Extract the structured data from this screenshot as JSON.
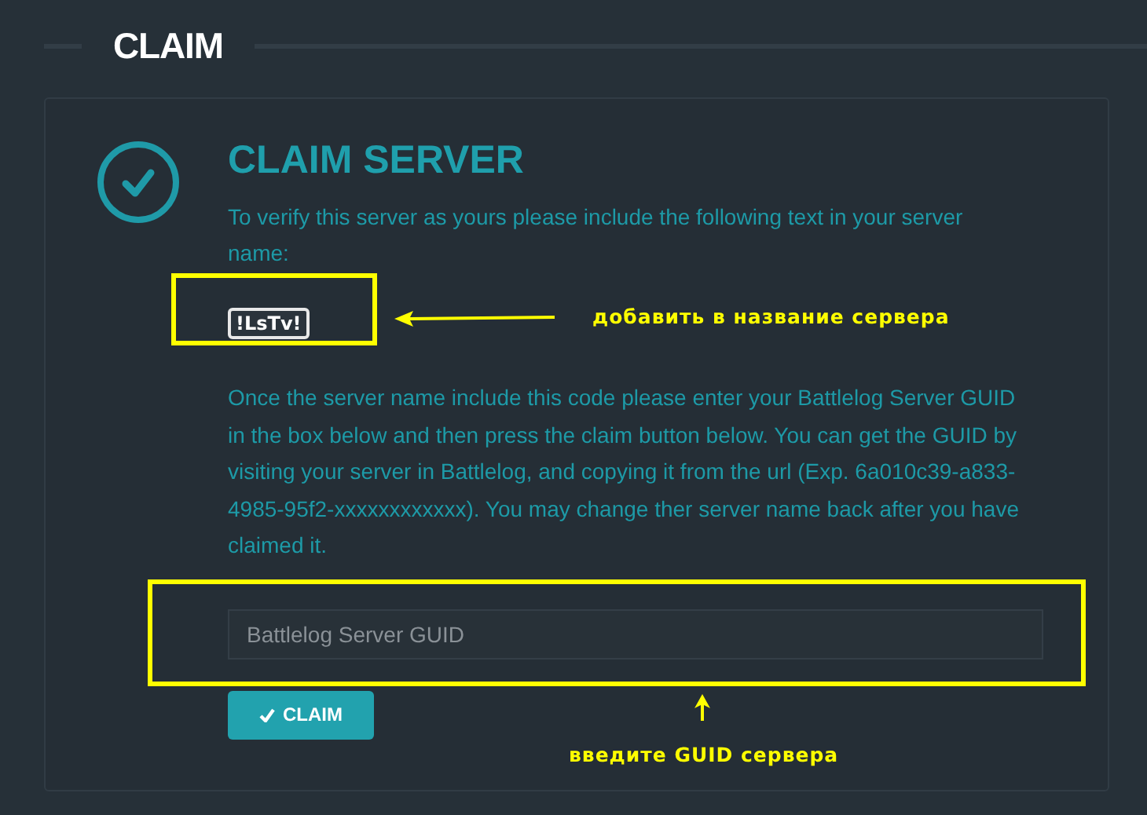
{
  "section_title": "CLAIM",
  "card": {
    "title": "CLAIM SERVER",
    "instruction": "To verify this server as yours please include the following text in your server name:",
    "code": "!LsTv!",
    "help_text": "Once the server name include this code please enter your Battlelog Server GUID in the box below and then press the claim button below. You can get the GUID by visiting your server in Battlelog, and copying it from the url (Exp. 6a010c39-a833-4985-95f2-xxxxxxxxxxxx). You may change ther server name back after you have claimed it.",
    "guid_field": {
      "placeholder": "Battlelog Server GUID"
    },
    "button": {
      "label": "CLAIM"
    }
  },
  "annotations": [
    {
      "kind": "left",
      "text": "добавить в название сервера"
    },
    {
      "kind": "up",
      "text": "введите GUID сервера"
    }
  ]
}
